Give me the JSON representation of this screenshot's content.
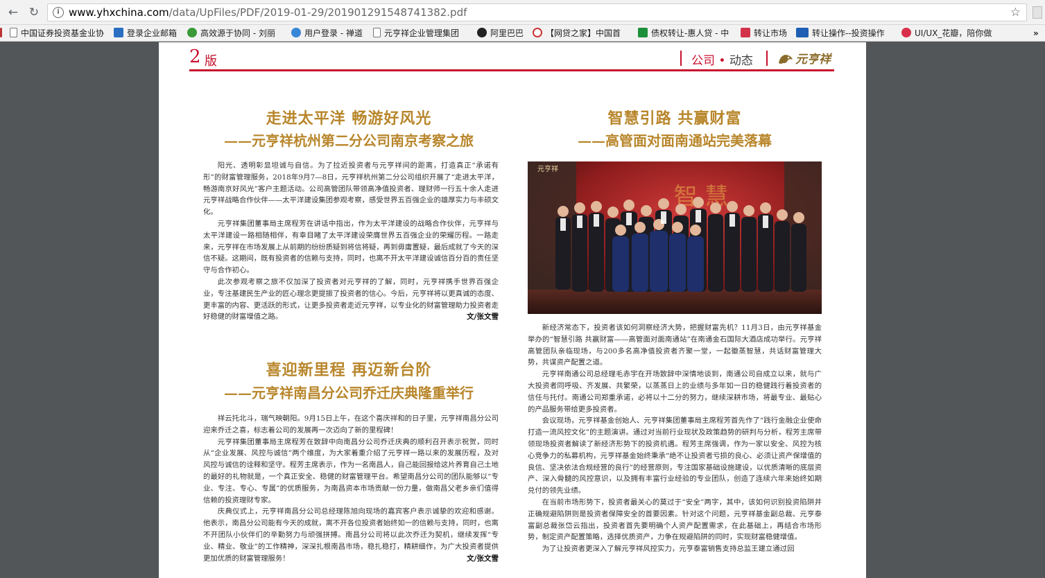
{
  "browser": {
    "url_host": "www.yhxchina.com",
    "url_path": "/data/UpFiles/PDF/2019-01-29/201901291548741382.pdf",
    "bookmarks": [
      "中国证券投资基金业协",
      "登录企业邮箱",
      "高效源于协同 - 刘丽",
      "用户登录 - 禅道",
      "元亨祥企业管理集团",
      "阿里巴巴",
      "【网贷之家】中国首",
      "债权转让-惠人贷 - 中",
      "转让市场",
      "转让操作--投资操作",
      "UI/UX_花瓣，陪你做"
    ],
    "bookmark_icons": [
      "page-icon",
      "mail-icon",
      "leaf-icon",
      "globe-icon",
      "page-icon",
      "github-icon",
      "p2p-icon",
      "tick-icon",
      "yen-icon",
      "lu-icon",
      "petal-icon"
    ]
  },
  "page": {
    "edition_num": "2",
    "edition_label": "版",
    "section_a": "公司",
    "section_dot": "•",
    "section_b": "动态",
    "brand": "元亨祥",
    "accent": "#c8102e",
    "title_color": "#b8862b"
  },
  "art1": {
    "title1": "走进太平洋  畅游好风光",
    "title2": "——元亨祥杭州第二分公司南京考察之旅",
    "paras": [
      "阳光、透明彰显坦诚与自信。为了拉近投资者与元亨祥间的距离，打造真正“承诺有形”的财富管理服务，2018年9月7—8日，元亨祥杭州第二分公司组织开展了“走进太平洋，畅游南京好风光”客户主题活动。公司高管团队带领高净值投资者、理财师一行五十余人走进元亨祥战略合作伙伴——太平洋建设集团参观考察，感受世界五百强企业的雄厚实力与丰硕文化。",
      "元亨祥集团董事局主席程芳在讲话中指出，作为太平洋建设的战略合作伙伴，元亨祥与太平洋建设一路相随相伴，有幸目睹了太平洋建设荣膺世界五百强企业的荣耀历程。一路走来，元亨祥在市场发展上从前期的纷纷质疑到将信将疑，再到毋庸置疑，最后成就了今天的深信不疑。这期间，既有投资者的信赖与支持，同时，也离不开太平洋建设诚信百分百的责任坚守与合作初心。",
      "此次参观考察之旅不仅加深了投资者对元亨祥的了解，同时，元亨祥携手世界百强企业，专注基建民生产业的匠心理念更提振了投资者的信心。今后，元亨祥将以更真诚的态度、更丰富的内容、更活跃的形式，让更多投资者走近元亨祥，以专业化的财富管理助力投资者走好稳健的财富增值之路。"
    ],
    "byline": "文/张文雪"
  },
  "art2": {
    "title1": "喜迎新里程  再迈新台阶",
    "title2": "——元亨祥南昌分公司乔迁庆典隆重举行",
    "paras": [
      "祥云托北斗，瑞气映朝阳。9月15日上午，在这个喜庆祥和的日子里，元亨祥南昌分公司迎来乔迁之喜，标志着公司的发展再一次迈向了新的里程碑！",
      "元亨祥集团董事局主席程芳在致辞中向南昌分公司乔迁庆典的顺利召开表示祝贺，同时从“企业发展、风控与诚信”两个维度，为大家着重介绍了元亨祥一路以来的发展历程，及对风控与诚信的诠释和坚守。程芳主席表示，作为一名南昌人，自己能回报给这片养育自己土地的最好的礼物就是，一个真正安全、稳健的财富管理平台。希望南昌分公司的团队能够以“专业、专注、专心、专属”的优质服务，为南昌资本市场贡献一份力量，做南昌父老乡亲们值得信赖的投资理财专家。",
      "庆典仪式上，元亨祥南昌分公司总经理陈旭向现场的嘉宾客户表示诚挚的欢迎和感谢。他表示，南昌分公司能有今天的成就，离不开各位投资者始终如一的信赖与支持，同时，也离不开团队小伙伴们的辛勤努力与顽强拼搏。南昌分公司将以此次乔迁为契机，继续发挥“专业、精业、敬业”的工作精神，深深扎根南昌市场，稳扎稳打，精耕细作，为广大投资者提供更加优质的财富管理服务！"
    ],
    "byline": "文/张文雪"
  },
  "art3": {
    "title1": "智慧引路  共赢财富",
    "title2": "——高管面对面南通站完美落幕",
    "photo_logo": "元亨祥",
    "photo_banner": "智 慧",
    "paras": [
      "新经济常态下，投资者该如何洞察经济大势，把握财富先机？11月3日，由元亨祥基金举办的“智慧引路 共赢财富——高管面对面南通站”在南通金石国际大酒店成功举行。元亨祥高管团队亲临现场，与200多名高净值投资者齐聚一堂，一起徽蒸智慧，共话财富管理大势，共谋资产配置之道。",
      "元亨祥南通公司总经理毛赤宇在开场致辞中深情地谈到，南通公司自成立以来，就与广大投资者同呼吸、齐发展、共繁荣，以蒸蒸日上的业绩与多年如一日的稳健践行着投资者的信任与托付。南通公司郑重承诺，必将以十二分的努力，继续深耕市场，将最专业、最贴心的产品服务带给更多投资者。",
      "会议现场，元亨祥基金创始人、元亨祥集团董事局主席程芳首先作了“践行金融企业使命 打造一流风控文化”的主题演讲。通过对当前行业现状及政策趋势的研判与分析，程芳主席带领现场投资者解读了新经济形势下的投资机遇。程芳主席强调，作为一家以安全、风控为核心竞争力的私募机构，元亨祥基金始终秉承“绝不让投资者亏损的良心、必须让资产保增值的良信、坚决依法合规经营的良行”的经营原则，专注国家基础设施建设，以优质清晰的底层资产、深入骨髓的风控意识，以及拥有丰富行业经验的专业团队，创造了连续六年来始终如期兑付的领先业绩。",
      "在当前市场形势下，投资者最关心的莫过于“安全”两字，其中，该如何识别投资陷阱并正确规避陷阱则是投资者保障安全的首要因素。针对这个问题，元亨祥基金副总裁、元亨泰富副总裁张岱云指出，投资者首先要明确个人资产配置需求，在此基础上，再结合市场形势，制定资产配置策略，选择优质资产，力争在规避陷阱的同时，实现财富稳健增值。",
      "为了让投资者更深入了解元亨祥风控实力，元亨泰富销售支持总监王建立通过回"
    ]
  }
}
